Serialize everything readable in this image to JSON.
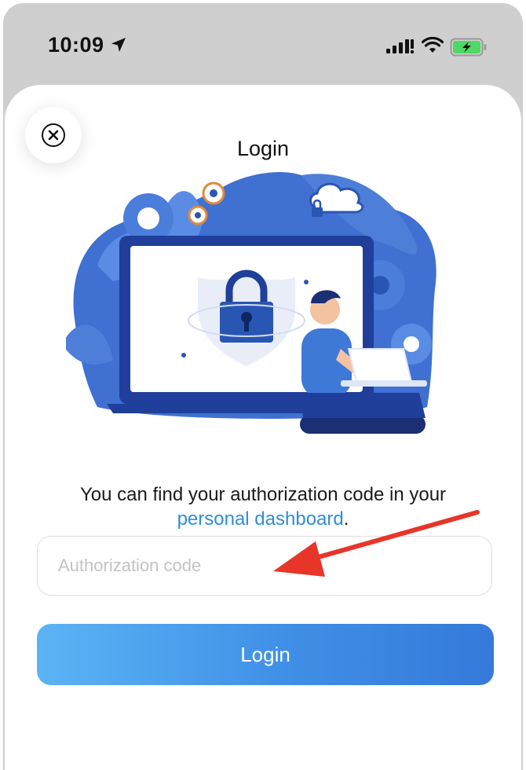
{
  "status_bar": {
    "time": "10:09",
    "icons": [
      "location-arrow-icon",
      "signal-icon",
      "wifi-icon",
      "battery-charging-icon"
    ]
  },
  "header": {
    "title": "Login",
    "close_icon": "close-icon"
  },
  "content": {
    "info_text": "You can find your authorization code in your",
    "link_text": "personal dashboard",
    "trailing": "."
  },
  "form": {
    "code_placeholder": "Authorization code",
    "code_value": "",
    "login_label": "Login"
  },
  "colors": {
    "link": "#2f8fd3",
    "button_start": "#5bb4f4",
    "button_end": "#357ad9",
    "annotation_arrow": "#e8352a",
    "battery": "#4cd964"
  }
}
